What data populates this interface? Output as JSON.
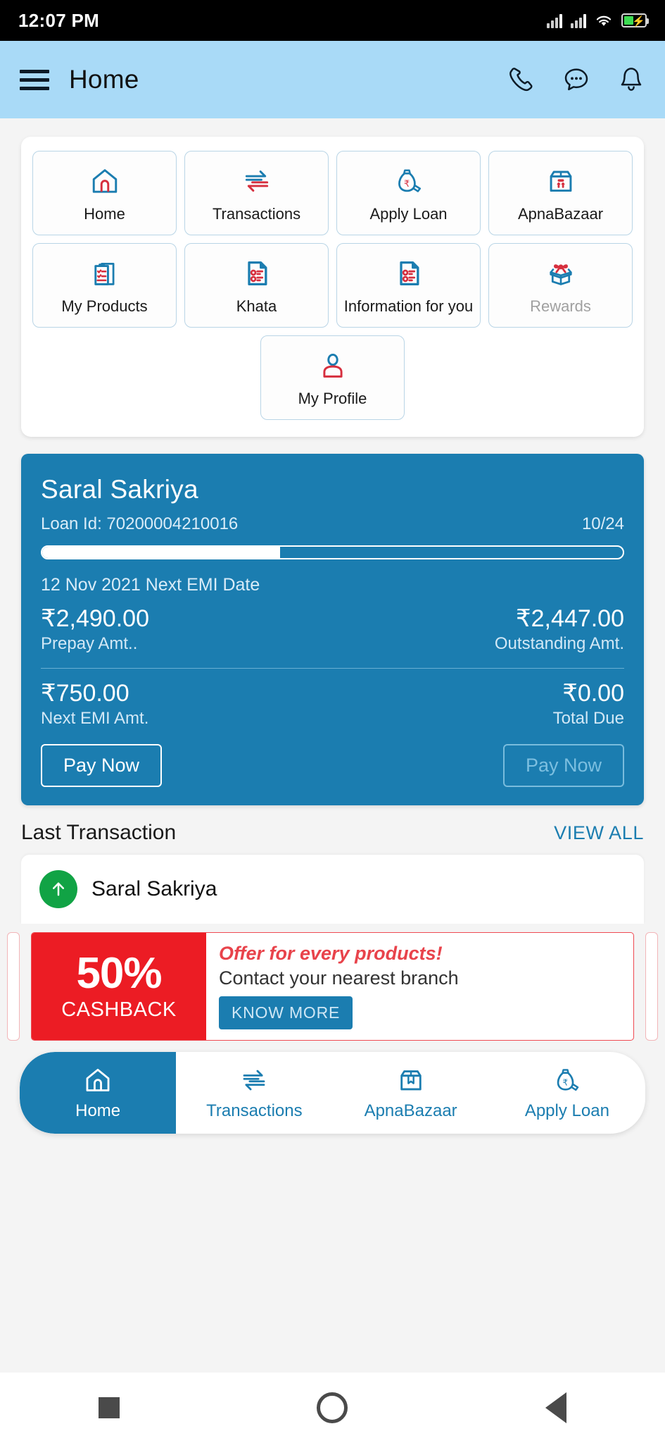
{
  "status_bar": {
    "time": "12:07 PM",
    "icons": [
      "signal-bars-icon",
      "signal-bars-icon",
      "wifi-icon",
      "battery-charging-icon"
    ]
  },
  "app_bar": {
    "menu_icon": "hamburger-menu-icon",
    "title": "Home",
    "actions": [
      "phone-icon",
      "chat-icon",
      "bell-icon"
    ]
  },
  "quick_menu": {
    "tiles": [
      {
        "label": "Home",
        "icon": "house-icon",
        "disabled": false
      },
      {
        "label": "Transactions",
        "icon": "exchange-arrows-icon",
        "disabled": false
      },
      {
        "label": "Apply Loan",
        "icon": "money-bag-icon",
        "disabled": false
      },
      {
        "label": "ApnaBazaar",
        "icon": "box-icon",
        "disabled": false
      },
      {
        "label": "My Products",
        "icon": "clipboard-icon",
        "disabled": false
      },
      {
        "label": "Khata",
        "icon": "document-list-icon",
        "disabled": false
      },
      {
        "label": "Information for you",
        "icon": "document-list-icon",
        "disabled": false
      },
      {
        "label": "Rewards",
        "icon": "gift-box-icon",
        "disabled": true
      }
    ],
    "profile_tile": {
      "label": "My Profile",
      "icon": "person-icon"
    }
  },
  "loan_card": {
    "product_name": "Saral Sakriya",
    "loan_id_label": "Loan Id: 70200004210016",
    "installment_counter": "10/24",
    "progress_percent": 41,
    "next_emi_date": "12 Nov 2021 Next EMI Date",
    "prepay_amount": "₹2,490.00",
    "prepay_caption": "Prepay Amt..",
    "outstanding_amount": "₹2,447.00",
    "outstanding_caption": "Outstanding Amt.",
    "next_emi_amount": "₹750.00",
    "next_emi_caption": "Next EMI Amt.",
    "total_due_amount": "₹0.00",
    "total_due_caption": "Total Due",
    "pay_now_primary": "Pay Now",
    "pay_now_secondary": "Pay Now"
  },
  "last_transaction": {
    "heading": "Last Transaction",
    "view_all": "VIEW ALL",
    "item_name": "Saral Sakriya",
    "item_icon": "arrow-up-circle-icon"
  },
  "promo_banner": {
    "percent": "50%",
    "cashback_label": "CASHBACK",
    "headline": "Offer for every products!",
    "subtext": "Contact your nearest branch",
    "cta": "KNOW MORE"
  },
  "bottom_nav": {
    "items": [
      {
        "label": "Home",
        "icon": "house-icon",
        "active": true
      },
      {
        "label": "Transactions",
        "icon": "exchange-arrows-icon",
        "active": false
      },
      {
        "label": "ApnaBazaar",
        "icon": "box-icon",
        "active": false
      },
      {
        "label": "Apply Loan",
        "icon": "money-bag-icon",
        "active": false
      }
    ]
  },
  "system_nav": {
    "buttons": [
      "recents-square-icon",
      "home-circle-icon",
      "back-triangle-icon"
    ]
  },
  "colors": {
    "brand_blue": "#1b7db0",
    "app_bar_blue": "#a9daf7",
    "accent_red": "#d62f3e",
    "promo_red": "#ec1c24",
    "success_green": "#11a345"
  }
}
